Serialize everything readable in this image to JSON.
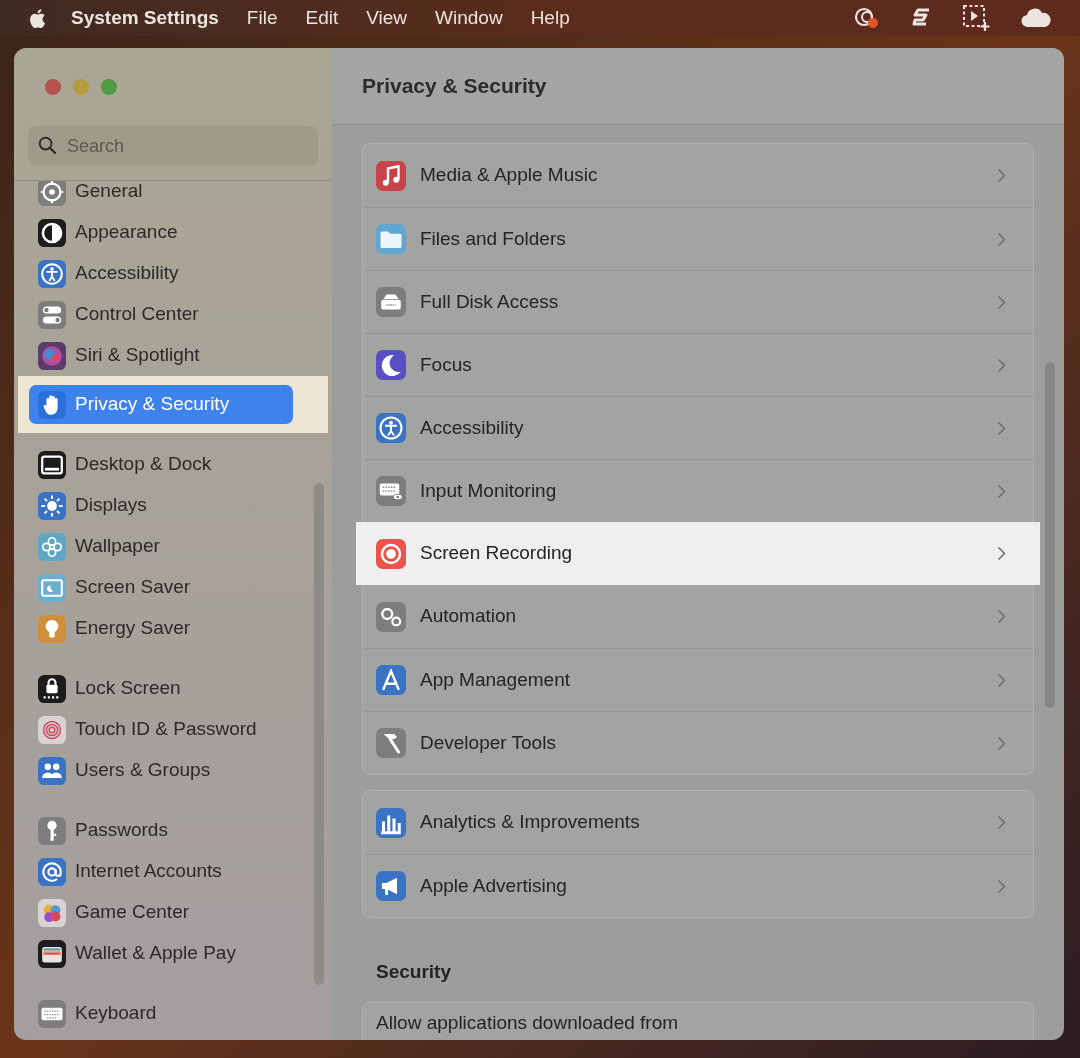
{
  "menu_bar": {
    "app_name": "System Settings",
    "menus": [
      "File",
      "Edit",
      "View",
      "Window",
      "Help"
    ]
  },
  "window": {
    "title": "Privacy & Security"
  },
  "sidebar": {
    "search": {
      "placeholder": "Search"
    },
    "groups": [
      {
        "items": [
          {
            "label": "General",
            "color": "#7d7d80",
            "selected": false,
            "highlighted": false
          },
          {
            "label": "Appearance",
            "color": "#1c1c1c",
            "selected": false,
            "highlighted": false
          },
          {
            "label": "Accessibility",
            "color": "#3a72c4",
            "selected": false,
            "highlighted": false
          },
          {
            "label": "Control Center",
            "color": "#7d7d80",
            "selected": false,
            "highlighted": false
          },
          {
            "label": "Siri & Spotlight",
            "color": "#5b3b6a",
            "selected": false,
            "highlighted": false
          },
          {
            "label": "Privacy & Security",
            "color": "#2a6fdc",
            "selected": true,
            "highlighted": true
          }
        ]
      },
      {
        "items": [
          {
            "label": "Desktop & Dock",
            "color": "#1c1c1c",
            "selected": false,
            "highlighted": false
          },
          {
            "label": "Displays",
            "color": "#3a72c4",
            "selected": false,
            "highlighted": false
          },
          {
            "label": "Wallpaper",
            "color": "#5fa6c4",
            "selected": false,
            "highlighted": false
          },
          {
            "label": "Screen Saver",
            "color": "#6aaed0",
            "selected": false,
            "highlighted": false
          },
          {
            "label": "Energy Saver",
            "color": "#d08f3a",
            "selected": false,
            "highlighted": false
          }
        ]
      },
      {
        "items": [
          {
            "label": "Lock Screen",
            "color": "#1c1c1c",
            "selected": false,
            "highlighted": false
          },
          {
            "label": "Touch ID & Password",
            "color": "#d8d4d2",
            "selected": false,
            "highlighted": false
          },
          {
            "label": "Users & Groups",
            "color": "#3a72c4",
            "selected": false,
            "highlighted": false
          }
        ]
      },
      {
        "items": [
          {
            "label": "Passwords",
            "color": "#7d7d80",
            "selected": false,
            "highlighted": false
          },
          {
            "label": "Internet Accounts",
            "color": "#3a72c4",
            "selected": false,
            "highlighted": false
          },
          {
            "label": "Game Center",
            "color": "#d8d4d2",
            "selected": false,
            "highlighted": false
          },
          {
            "label": "Wallet & Apple Pay",
            "color": "#1c1c1c",
            "selected": false,
            "highlighted": false
          }
        ]
      },
      {
        "items": [
          {
            "label": "Keyboard",
            "color": "#7d7d80",
            "selected": false,
            "highlighted": false
          }
        ]
      }
    ]
  },
  "main": {
    "sections": [
      {
        "items": [
          {
            "label": "Media & Apple Music",
            "color": "#c9434b",
            "highlighted": false
          },
          {
            "label": "Files and Folders",
            "color": "#5fa6d0",
            "highlighted": false
          },
          {
            "label": "Full Disk Access",
            "color": "#7d7d80",
            "highlighted": false
          },
          {
            "label": "Focus",
            "color": "#5a4fc0",
            "highlighted": false
          },
          {
            "label": "Accessibility",
            "color": "#3a72c4",
            "highlighted": false
          },
          {
            "label": "Input Monitoring",
            "color": "#7d7d80",
            "highlighted": false
          },
          {
            "label": "Screen Recording",
            "color": "#e9544c",
            "highlighted": true
          },
          {
            "label": "Automation",
            "color": "#7d7d80",
            "highlighted": false
          },
          {
            "label": "App Management",
            "color": "#3a72c4",
            "highlighted": false
          },
          {
            "label": "Developer Tools",
            "color": "#7d7d80",
            "highlighted": false
          }
        ]
      },
      {
        "items": [
          {
            "label": "Analytics & Improvements",
            "color": "#3a72c4",
            "highlighted": false
          },
          {
            "label": "Apple Advertising",
            "color": "#3a72c4",
            "highlighted": false
          }
        ]
      }
    ],
    "security": {
      "heading": "Security",
      "text": "Allow applications downloaded from"
    }
  }
}
